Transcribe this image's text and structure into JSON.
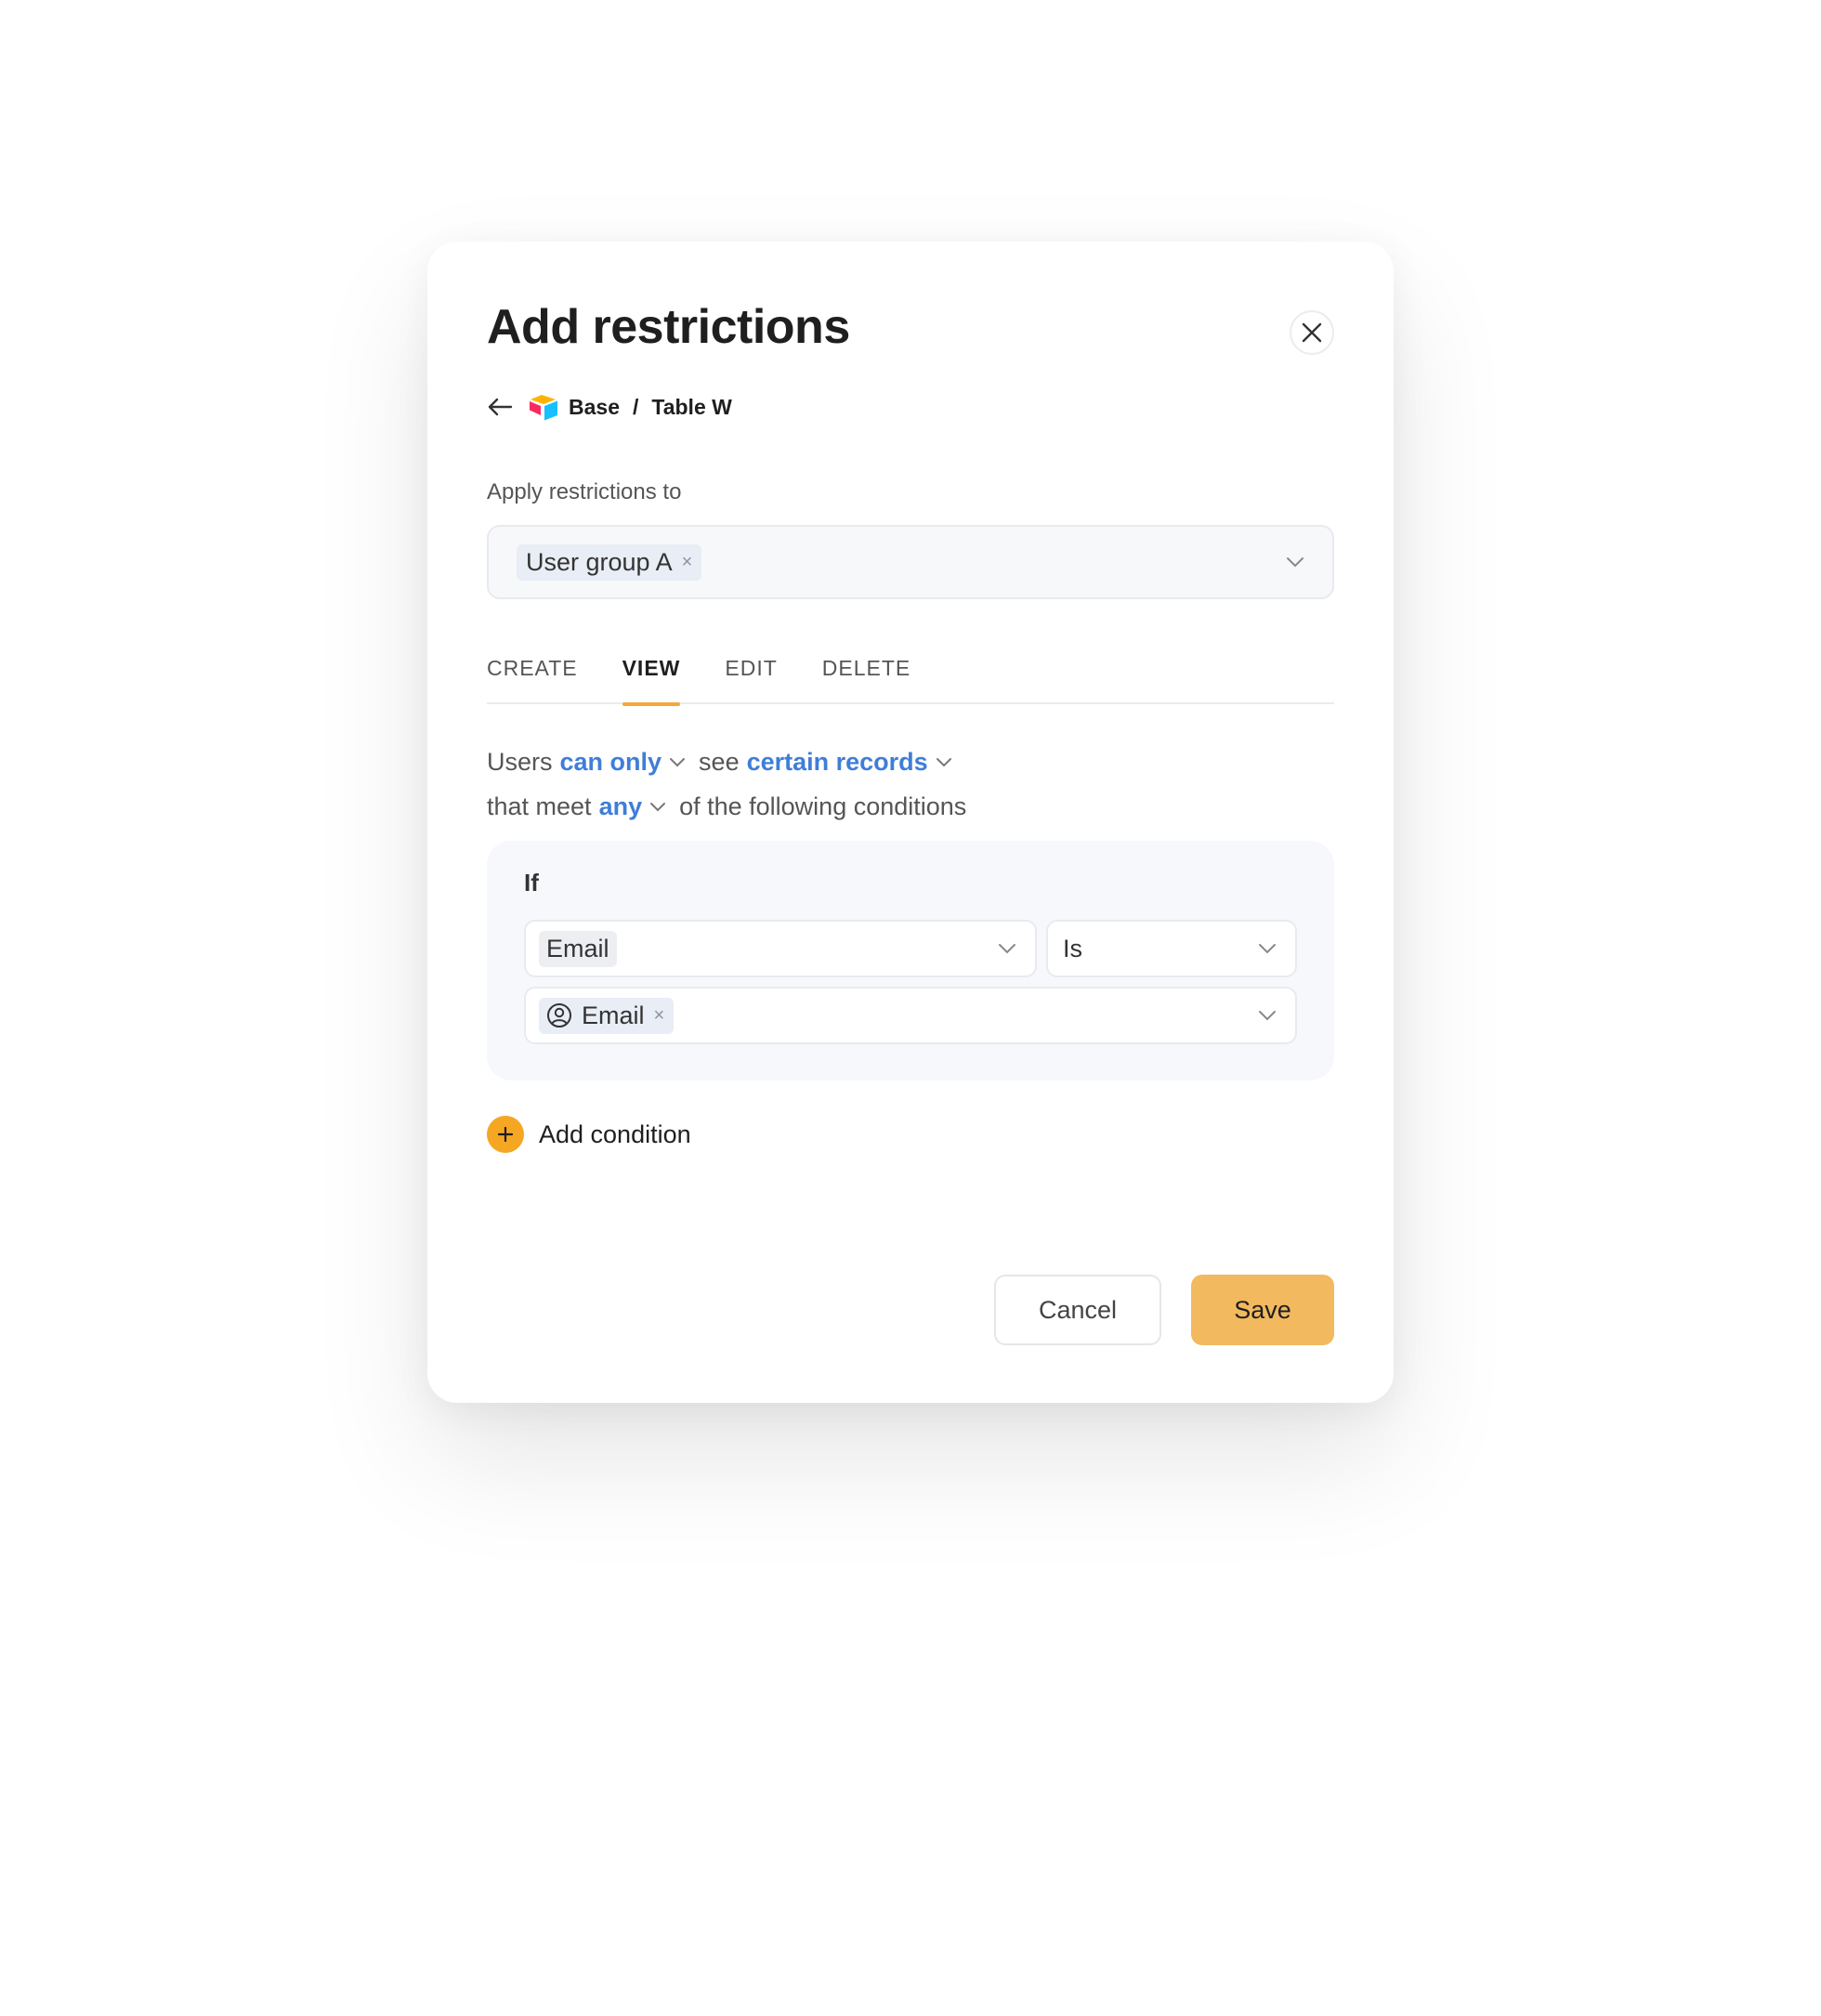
{
  "modal": {
    "title": "Add restrictions",
    "close_icon": "close-icon"
  },
  "breadcrumb": {
    "back_icon": "arrow-left-icon",
    "app_icon": "airtable-logo-icon",
    "base": "Base",
    "separator": "/",
    "table": "Table W"
  },
  "apply": {
    "label": "Apply restrictions to",
    "selected": "User group A",
    "remove": "×"
  },
  "tabs": [
    {
      "label": "CREATE",
      "active": false
    },
    {
      "label": "VIEW",
      "active": true
    },
    {
      "label": "EDIT",
      "active": false
    },
    {
      "label": "DELETE",
      "active": false
    }
  ],
  "rule": {
    "users": "Users",
    "permission": "can only",
    "see": "see",
    "scope": "certain records",
    "that_meet": "that meet",
    "match": "any",
    "suffix": "of the following conditions"
  },
  "condition": {
    "if_label": "If",
    "field": "Email",
    "operator": "Is",
    "value": "Email",
    "value_icon": "user-circle-icon",
    "value_remove": "×"
  },
  "add_condition": {
    "label": "Add condition",
    "icon": "plus-icon"
  },
  "footer": {
    "cancel": "Cancel",
    "save": "Save"
  },
  "colors": {
    "accent_blue": "#3f7ed8",
    "accent_orange": "#f5a623",
    "save_button": "#f3b95f",
    "tab_underline": "#f2a93a"
  }
}
